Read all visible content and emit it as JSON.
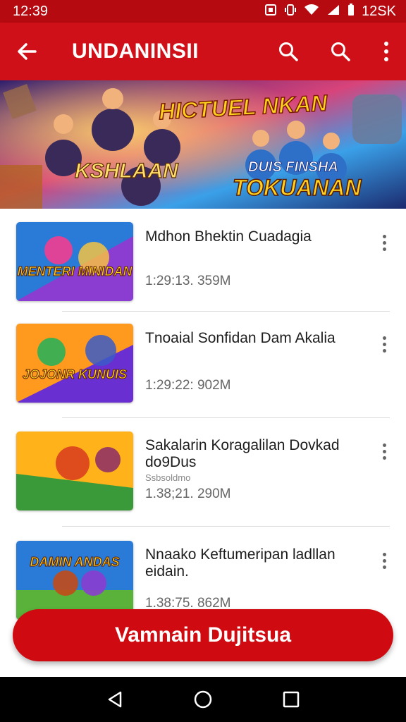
{
  "status_bar": {
    "time": "12:39",
    "right_text": "12SK"
  },
  "app_bar": {
    "title": "UNDANINSII",
    "icons": [
      "back-arrow-icon",
      "search-icon",
      "search-icon",
      "more-vert-icon"
    ]
  },
  "banner": {
    "title": "HICTUEL NKAN",
    "logo_text": "KSHLAAN",
    "sub1": "DUIS FINSHA",
    "sub2": "TOKUANAN"
  },
  "items": [
    {
      "title": "Mdhon Bhektin Cuadagia",
      "meta": "1:29:13. 359M",
      "extra": "",
      "thumb_text": "MENTERI MINIDAN",
      "thumb_colors": [
        "#2a7bd8",
        "#8a3dd0",
        "#ff3a8c"
      ]
    },
    {
      "title": "Tnoaial Sonfidan Dam Akalia",
      "meta": "1:29:22: 902M",
      "extra": "",
      "thumb_text": "JOJONR KUNUIS",
      "thumb_colors": [
        "#ff9a1f",
        "#6a2fd0",
        "#1fb25a"
      ]
    },
    {
      "title": "Sakalarin Koragalilan Dovkad do9Dus",
      "meta": "1.38;21. 290M",
      "extra": "Ssbsoldmo",
      "thumb_text": "",
      "thumb_colors": [
        "#ffb21a",
        "#3a9a3a",
        "#d83a20"
      ]
    },
    {
      "title": "Nnaako Keftumeripan ladllan eidain.",
      "meta": "1.38:75. 862M",
      "extra": "",
      "thumb_text": "DAMIN ANDAS",
      "thumb_colors": [
        "#2a7bd8",
        "#c34a1a",
        "#5ab23a"
      ]
    }
  ],
  "cta": {
    "label": "Vamnain Dujitsua"
  },
  "nav_bar": {
    "icons": [
      "back-triangle-icon",
      "home-circle-icon",
      "recents-square-icon"
    ]
  }
}
